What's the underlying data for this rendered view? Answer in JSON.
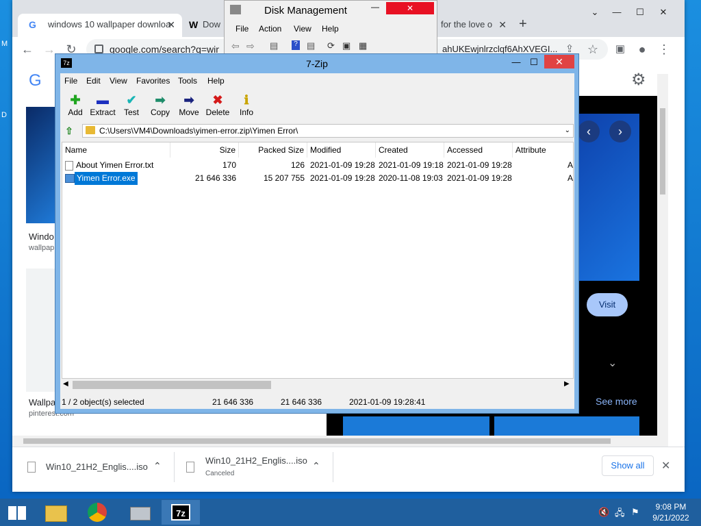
{
  "chrome": {
    "tabs": [
      {
        "label": "windows 10 wallpaper downloa",
        "icon": "G"
      },
      {
        "label": "Dow",
        "icon": "W"
      },
      {
        "label": "for the love o",
        "icon": ""
      }
    ],
    "url": "google.com/search?q=win",
    "url_tail": "ahUKEwjnlrzclqf6AhXVEGI...",
    "new_tab": "+",
    "visit_label": "Visit",
    "see_more": "See more",
    "left_results": [
      {
        "title": "Windo",
        "source": "wallpap"
      },
      {
        "title": "Wallpa",
        "source": "pinterest.com"
      }
    ]
  },
  "disk_management": {
    "title": "Disk Management",
    "menu": [
      "File",
      "Action",
      "View",
      "Help"
    ]
  },
  "zip": {
    "title": "7-Zip",
    "menu": [
      "File",
      "Edit",
      "View",
      "Favorites",
      "Tools",
      "Help"
    ],
    "toolbar": [
      {
        "label": "Add",
        "icon": "add-icon",
        "glyph": "✚",
        "color": "#1fa51f"
      },
      {
        "label": "Extract",
        "icon": "extract-icon",
        "glyph": "▬",
        "color": "#1c2fbf"
      },
      {
        "label": "Test",
        "icon": "test-icon",
        "glyph": "✔",
        "color": "#19b5b5"
      },
      {
        "label": "Copy",
        "icon": "copy-icon",
        "glyph": "➡",
        "color": "#1e8c6a"
      },
      {
        "label": "Move",
        "icon": "move-icon",
        "glyph": "➡",
        "color": "#1a237e"
      },
      {
        "label": "Delete",
        "icon": "delete-icon",
        "glyph": "✖",
        "color": "#d41a1a"
      },
      {
        "label": "Info",
        "icon": "info-icon",
        "glyph": "ℹ",
        "color": "#c9a400"
      }
    ],
    "path": "C:\\Users\\VM4\\Downloads\\yimen-error.zip\\Yimen Error\\",
    "columns": [
      "Name",
      "Size",
      "Packed Size",
      "Modified",
      "Created",
      "Accessed",
      "Attribute"
    ],
    "rows": [
      {
        "name": "About Yimen Error.txt",
        "size": "170",
        "packed": "126",
        "modified": "2021-01-09 19:28",
        "created": "2021-01-09 19:18",
        "accessed": "2021-01-09 19:28",
        "attr": "A"
      },
      {
        "name": "Yimen Error.exe",
        "size": "21 646 336",
        "packed": "15 207 755",
        "modified": "2021-01-09 19:28",
        "created": "2020-11-08 19:03",
        "accessed": "2021-01-09 19:28",
        "attr": "A"
      }
    ],
    "status": {
      "selected": "1 / 2 object(s) selected",
      "size": "21 646 336",
      "size2": "21 646 336",
      "date": "2021-01-09 19:28:41"
    }
  },
  "downloads": {
    "items": [
      {
        "name": "Win10_21H2_Englis....iso",
        "status": ""
      },
      {
        "name": "Win10_21H2_Englis....iso",
        "status": "Canceled"
      }
    ],
    "show_all": "Show all"
  },
  "taskbar": {
    "time": "9:08 PM",
    "date": "9/21/2022"
  }
}
